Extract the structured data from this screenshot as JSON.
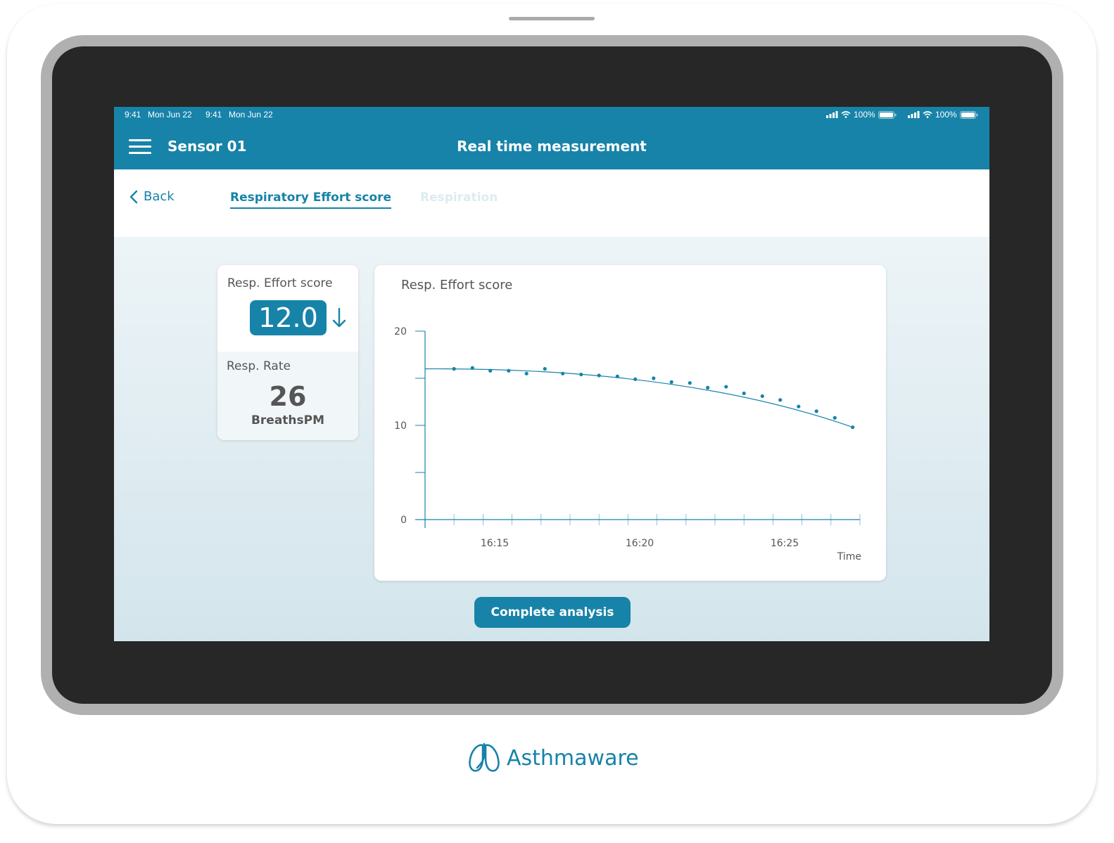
{
  "status_bar": {
    "left_time_1": "9:41",
    "left_date_1": "Mon Jun 22",
    "left_time_2": "9:41",
    "left_date_2": "Mon Jun 22",
    "battery_1": "100%",
    "battery_2": "100%"
  },
  "header": {
    "sensor_name": "Sensor 01",
    "title": "Real time measurement"
  },
  "nav": {
    "back_label": "Back",
    "tabs": [
      {
        "label": "Respiratory Effort score",
        "active": true
      },
      {
        "label": "Respiration",
        "active": false
      }
    ]
  },
  "stats": {
    "effort_label": "Resp. Effort score",
    "effort_value": "12.0",
    "trend_icon": "arrow-down-icon",
    "rate_label": "Resp. Rate",
    "rate_value": "26",
    "rate_unit": "BreathsPM"
  },
  "chart_data": {
    "type": "scatter",
    "title": "Resp. Effort score",
    "xlabel": "Time",
    "ylabel": "",
    "ylim": [
      0,
      20
    ],
    "yticks": [
      "0",
      "10",
      "20"
    ],
    "xticks": [
      "16:15",
      "16:20",
      "16:25"
    ],
    "x_start_label": "16:15",
    "series": [
      {
        "x": [
          "16:13:30",
          "16:14:08",
          "16:14:45",
          "16:15:23",
          "16:16:00",
          "16:16:38",
          "16:17:15",
          "16:17:53",
          "16:18:30",
          "16:19:08",
          "16:19:45",
          "16:20:23",
          "16:21:00",
          "16:21:38",
          "16:22:15",
          "16:22:53",
          "16:23:30",
          "16:24:08",
          "16:24:45",
          "16:25:23",
          "16:26:00",
          "16:26:38",
          "16:27:15"
        ],
        "values": [
          16.0,
          16.1,
          15.8,
          15.8,
          15.5,
          16.0,
          15.5,
          15.4,
          15.3,
          15.2,
          14.9,
          15.0,
          14.6,
          14.5,
          14.0,
          14.1,
          13.4,
          13.1,
          12.7,
          12.0,
          11.5,
          10.8,
          9.8
        ],
        "trend": "decreasing fitted curve"
      }
    ],
    "colors": {
      "series": "#1783a8",
      "axis": "#1783a8"
    },
    "grid": false
  },
  "actions": {
    "complete_label": "Complete analysis"
  },
  "brand": {
    "name": "Asthmaware",
    "logo_icon": "lungs-logo-icon"
  }
}
